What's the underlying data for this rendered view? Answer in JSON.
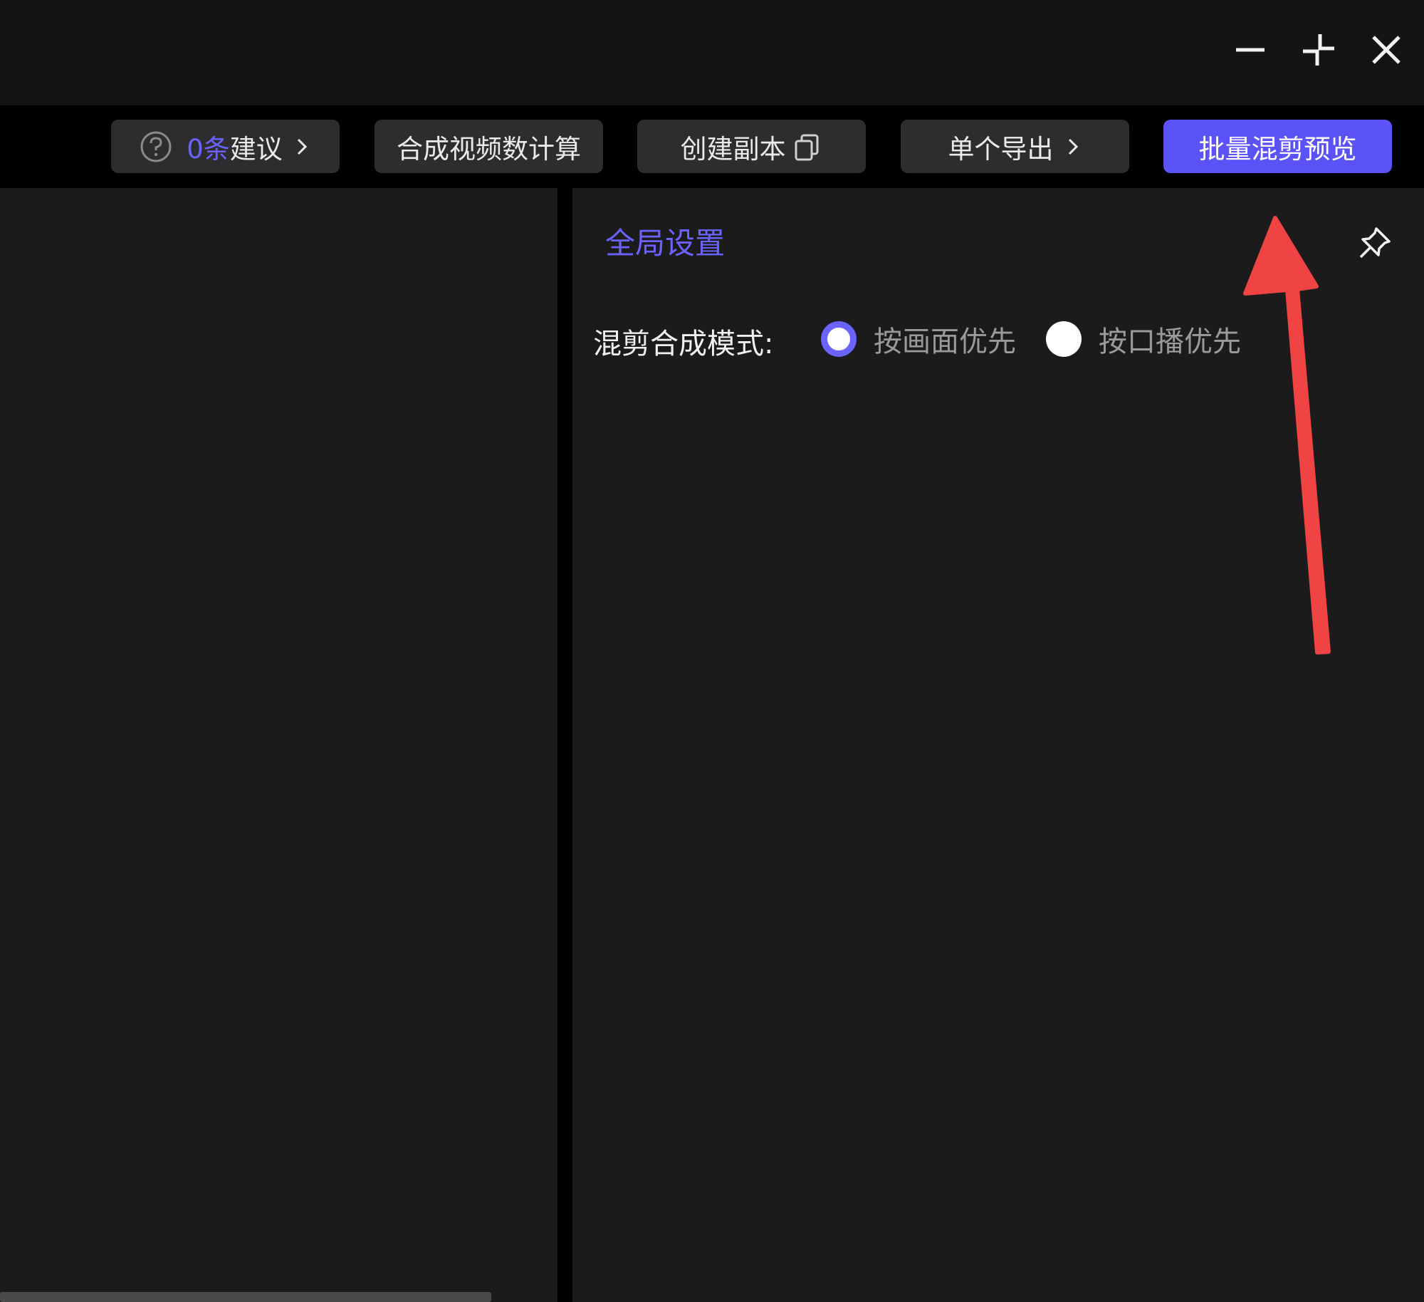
{
  "window_controls": {
    "minimize_icon": "minimize-icon",
    "restore_icon": "restore-icon",
    "close_icon": "close-icon"
  },
  "toolbar": {
    "suggestions": {
      "count": "0条",
      "label": "建议",
      "icon": "question-circle-icon"
    },
    "calc_label": "合成视频数计算",
    "copy_label": "创建副本",
    "export_label": "单个导出",
    "batch_label": "批量混剪预览"
  },
  "settings": {
    "title": "全局设置",
    "mode_label": "混剪合成模式:",
    "options": [
      {
        "label": "按画面优先",
        "selected": true
      },
      {
        "label": "按口播优先",
        "selected": false
      }
    ]
  },
  "colors": {
    "accent": "#6b63ff",
    "primary_button": "#5b52f7",
    "annotation_arrow": "#f04444",
    "panel_bg": "#1b1b1b"
  }
}
